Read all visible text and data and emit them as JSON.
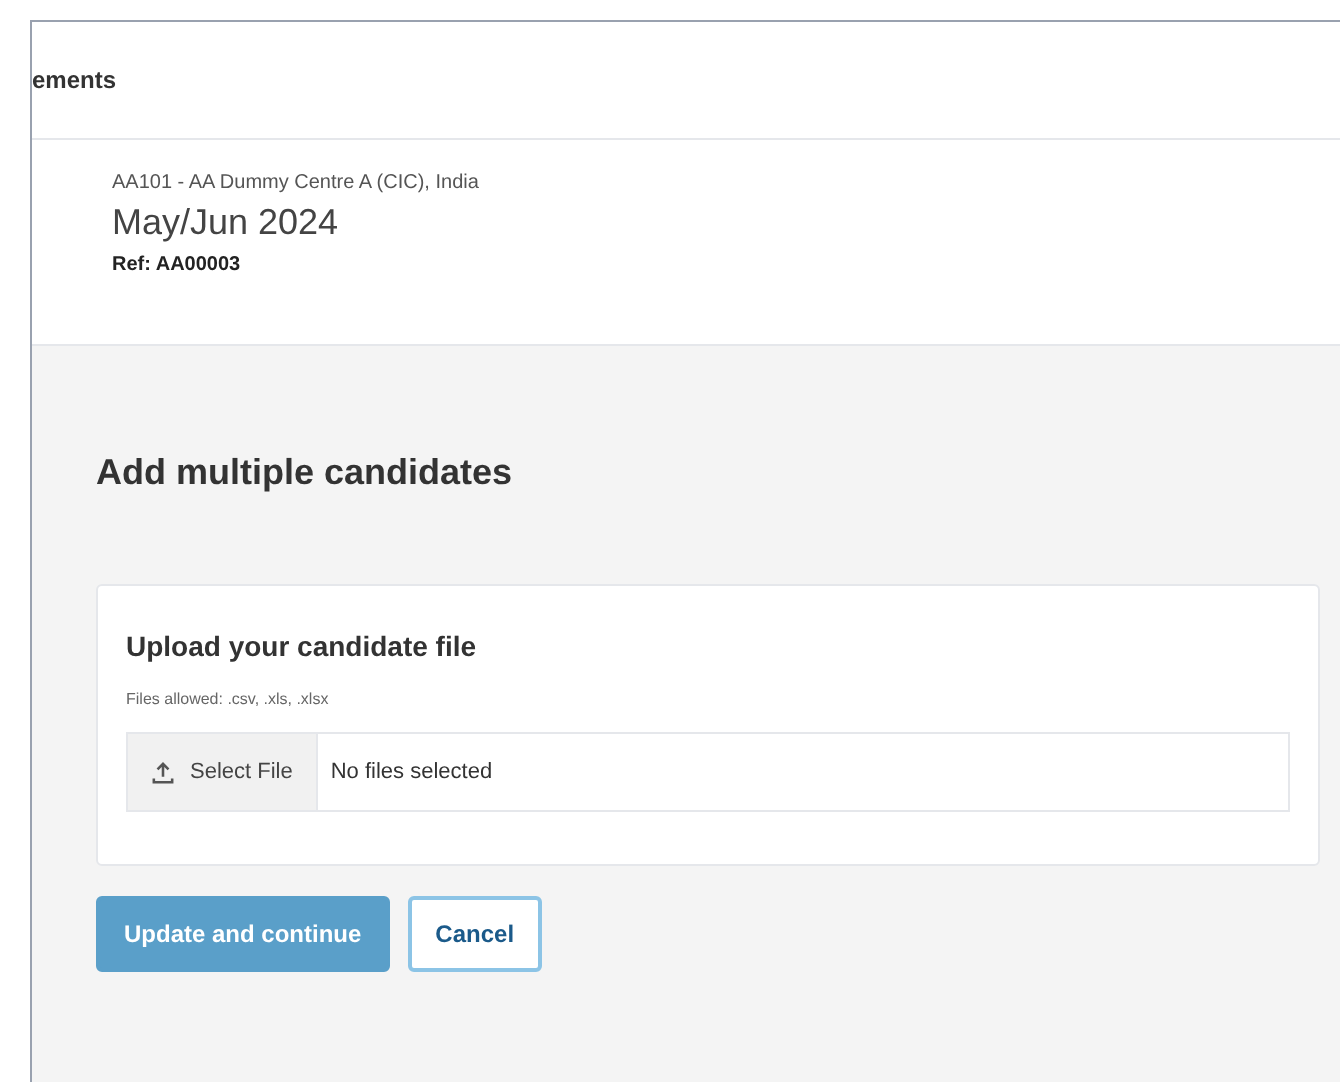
{
  "header": {
    "title": "ements"
  },
  "summary": {
    "centre": "AA101 - AA Dummy Centre A (CIC), India",
    "series": "May/Jun 2024",
    "reference": "Ref: AA00003"
  },
  "page_title": "Add multiple candidates",
  "upload": {
    "title": "Upload your candidate file",
    "hint": "Files allowed: .csv, .xls, .xlsx",
    "button": "Select File",
    "file_status": "No files selected"
  },
  "actions": [
    {
      "kind": "primary",
      "label": "Update and continue",
      "disabled": true
    },
    {
      "kind": "secondary",
      "label": "Cancel",
      "disabled": false
    }
  ]
}
